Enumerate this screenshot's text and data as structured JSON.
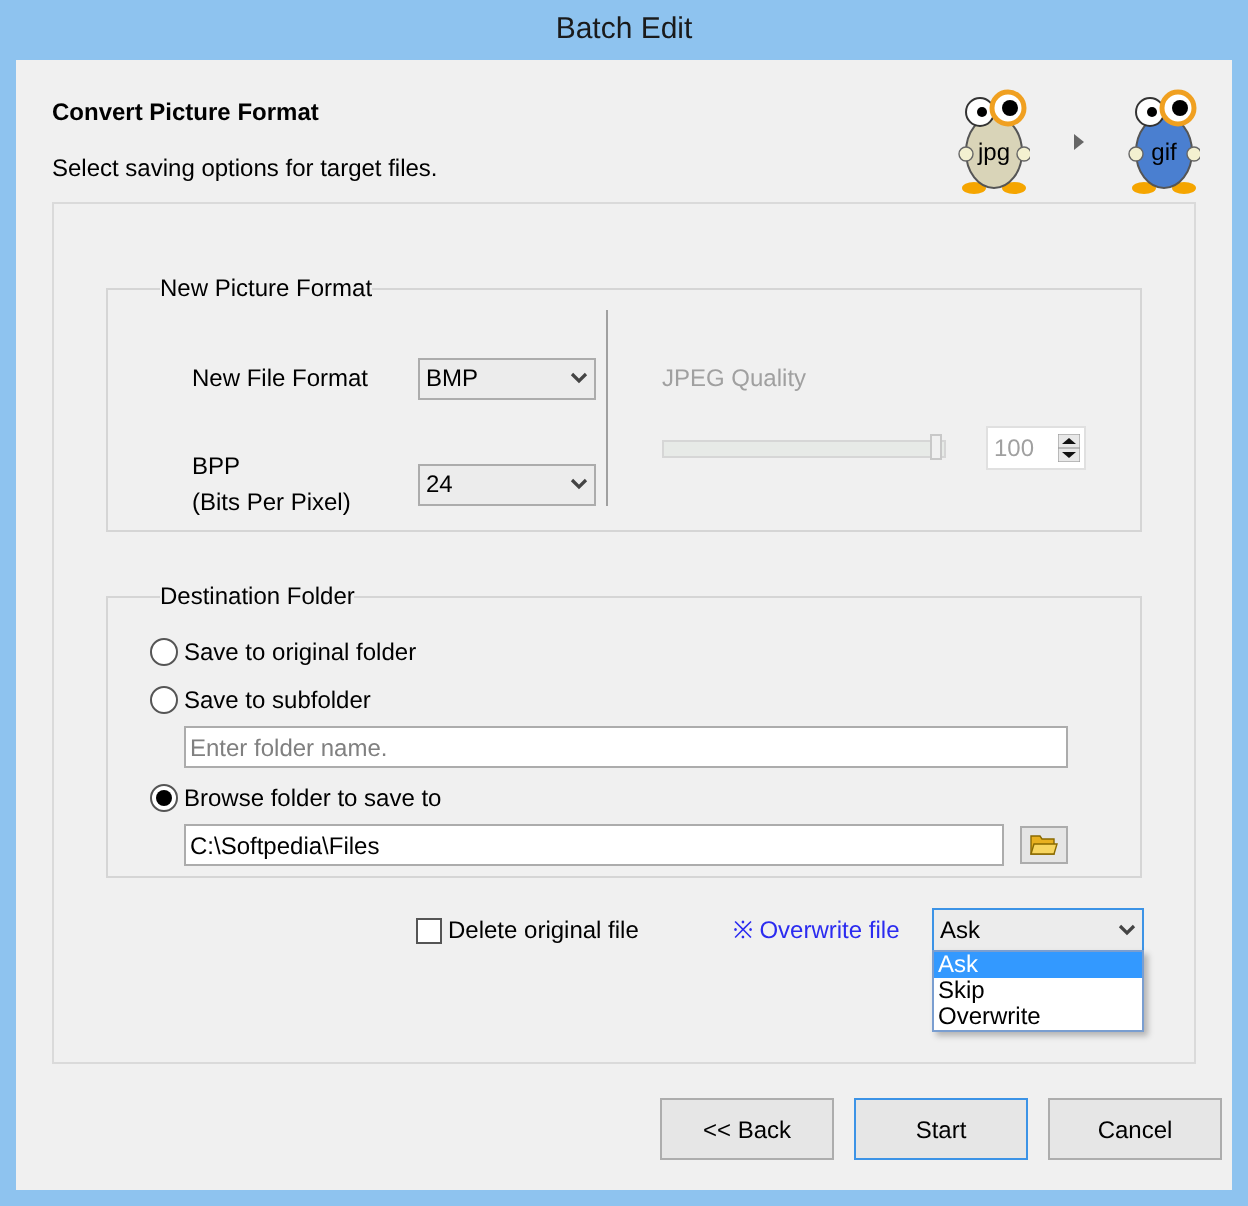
{
  "window": {
    "title": "Batch Edit"
  },
  "header": {
    "title": "Convert Picture Format",
    "subtitle": "Select saving options for target files.",
    "source_format": "jpg",
    "target_format": "gif"
  },
  "picture_format": {
    "legend": "New Picture Format",
    "fields": [
      {
        "label": "New File Format",
        "value": "BMP"
      },
      {
        "label": "BPP\n(Bits Per Pixel)",
        "value": "24"
      }
    ],
    "jpeg_quality": {
      "label": "JPEG Quality",
      "disabled": true,
      "level": 0.96,
      "value": "100"
    }
  },
  "destination": {
    "legend": "Destination Folder",
    "options": [
      {
        "label": "Save to original folder",
        "selected": false
      },
      {
        "label": "Save to subfolder",
        "selected": false,
        "field": {
          "placeholder": "Enter folder name."
        }
      },
      {
        "label": "Browse folder to save to",
        "selected": true,
        "field": {
          "value": "C:\\Softpedia\\Files"
        },
        "browse": true
      }
    ]
  },
  "delete_original": {
    "label": "Delete original file",
    "checked": false
  },
  "overwrite": {
    "label": "※ Overwrite file",
    "value": "Ask",
    "expanded": true,
    "items": [
      {
        "label": "Ask",
        "selected": true
      },
      {
        "label": "Skip",
        "selected": false
      },
      {
        "label": "Overwrite",
        "selected": false
      }
    ]
  },
  "buttons": [
    {
      "label": "<< Back",
      "default": false
    },
    {
      "label": "Start",
      "default": true
    },
    {
      "label": "Cancel",
      "default": false
    }
  ]
}
